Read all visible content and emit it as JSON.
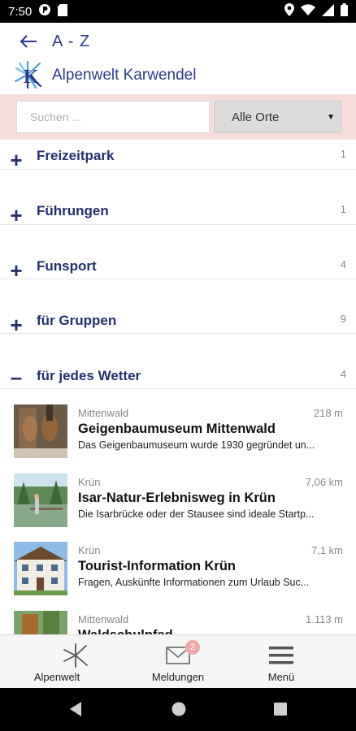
{
  "status_bar": {
    "time": "7:50"
  },
  "header": {
    "title": "A - Z",
    "brand_name": "Alpenwelt Karwendel"
  },
  "search": {
    "placeholder": "Suchen ...",
    "value": ""
  },
  "place_filter": {
    "selected": "Alle Orte"
  },
  "categories": [
    {
      "label": "Freizeitpark",
      "count": "1",
      "sign": "+"
    },
    {
      "label": "Führungen",
      "count": "1",
      "sign": "+"
    },
    {
      "label": "Funsport",
      "count": "4",
      "sign": "+"
    },
    {
      "label": "für Gruppen",
      "count": "9",
      "sign": "+"
    },
    {
      "label": "für jedes Wetter",
      "count": "4",
      "sign": "–"
    }
  ],
  "items": [
    {
      "place": "Mittenwald",
      "distance": "218 m",
      "title": "Geigenbaumuseum Mittenwald",
      "desc": "Das Geigenbaumuseum wurde 1930 gegründet un..."
    },
    {
      "place": "Krün",
      "distance": "7,06 km",
      "title": "Isar-Natur-Erlebnisweg in Krün",
      "desc": "Die Isarbrücke oder der Stausee sind ideale Startp..."
    },
    {
      "place": "Krün",
      "distance": "7,1 km",
      "title": "Tourist-Information Krün",
      "desc": "Fragen, Auskünfte Informationen zum Urlaub Suc..."
    },
    {
      "place": "Mittenwald",
      "distance": "1.113 m",
      "title": "Waldschulpfad",
      "desc": ""
    }
  ],
  "bottom_nav": {
    "home_label": "Alpenwelt",
    "messages_label": "Meldungen",
    "messages_badge": "2",
    "menu_label": "Menü"
  },
  "colors": {
    "brand": "#2b3a8c",
    "category": "#22306e",
    "search_bg": "#f7dcdc"
  }
}
